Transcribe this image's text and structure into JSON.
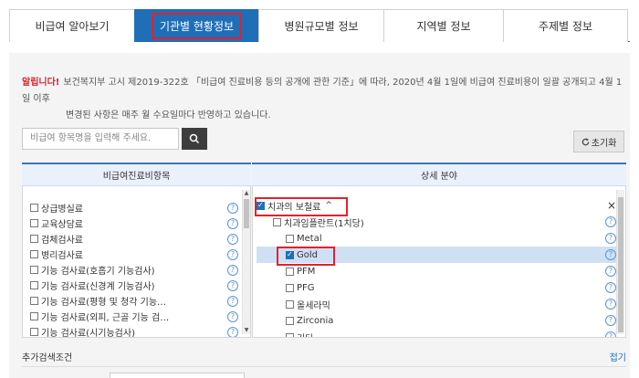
{
  "tabs": [
    {
      "label": "비급여 알아보기"
    },
    {
      "label": "기관별 현황정보"
    },
    {
      "label": "병원규모별 정보"
    },
    {
      "label": "지역별 정보"
    },
    {
      "label": "주제별 정보"
    }
  ],
  "notice": {
    "alert_label": "알립니다!",
    "line1": "보건복지부 고시 제2019-322호 「비급여 진료비용 등의 공개에 관한 기준」에 따라, 2020년 4월 1일에 비급여 진료비용이 일괄 공개되고 4월 1일 이후",
    "line2": "변경된 사항은 매주 월 수요일마다 반영하고 있습니다."
  },
  "search": {
    "placeholder": "비급여 항목명을 입력해 주세요.",
    "reset_label": "초기화"
  },
  "left_panel": {
    "header": "비급여진료비항목",
    "items": [
      {
        "label": "상급병실료"
      },
      {
        "label": "교육상담료"
      },
      {
        "label": "검체검사료"
      },
      {
        "label": "병리검사료"
      },
      {
        "label": "기능 검사료(호흡기 기능검사)"
      },
      {
        "label": "기능 검사료(신경계 기능검사)"
      },
      {
        "label": "기능 검사료(평형 및 청각 기능…"
      },
      {
        "label": "기능 검사료(외피, 근골 기능 검…"
      },
      {
        "label": "기능 검사료(시기능검사)"
      }
    ],
    "help_glyph": "?"
  },
  "right_panel": {
    "header": "상세 분야",
    "category": {
      "label": "치과의 보철료",
      "toggle_glyph": "^",
      "close_glyph": "×"
    },
    "subcategory": {
      "label": "치과임플란트(1치당)"
    },
    "items": [
      {
        "label": "Metal",
        "checked": false
      },
      {
        "label": "Gold",
        "checked": true
      },
      {
        "label": "PFM",
        "checked": false
      },
      {
        "label": "PFG",
        "checked": false
      },
      {
        "label": "올세라믹",
        "checked": false
      },
      {
        "label": "Zirconia",
        "checked": false
      },
      {
        "label": "기타",
        "checked": false
      }
    ],
    "help_glyph": "?"
  },
  "extra_conditions": {
    "label": "추가검색조건",
    "fold_label": "접기"
  },
  "colors": {
    "accent": "#1f6fb8",
    "highlight": "#e5202d",
    "alert": "#d9232e",
    "selected_row": "#cfe0f5"
  },
  "icons": {
    "search": "search-icon",
    "reset": "refresh-icon",
    "help": "help-icon",
    "close": "close-icon",
    "collapse": "chevron-up-icon"
  }
}
